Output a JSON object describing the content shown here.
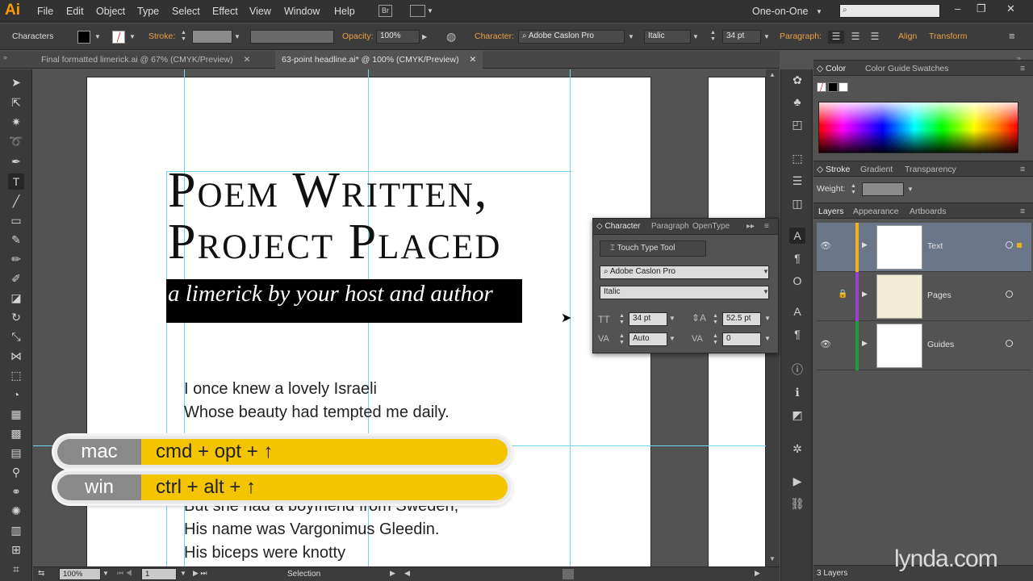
{
  "app": {
    "logo": "Ai",
    "workspace": "One-on-One"
  },
  "menu": [
    "File",
    "Edit",
    "Object",
    "Type",
    "Select",
    "Effect",
    "View",
    "Window",
    "Help"
  ],
  "menu_icons": [
    "Br"
  ],
  "control": {
    "label": "Characters",
    "stroke_label": "Stroke:",
    "opacity_label": "Opacity:",
    "opacity_value": "100%",
    "character_label": "Character:",
    "font": "Adobe Caslon Pro",
    "style": "Italic",
    "size": "34 pt",
    "paragraph_label": "Paragraph:",
    "align_label": "Align",
    "transform_label": "Transform"
  },
  "tabs": [
    {
      "label": "Final formatted limerick.ai @ 67% (CMYK/Preview)"
    },
    {
      "label": "63-point headline.ai* @ 100% (CMYK/Preview)"
    }
  ],
  "artwork": {
    "headline_line1": "Poem Written,",
    "headline_line2": "Project Placed",
    "subtitle": "a limerick by your host and author",
    "poem": [
      "I once knew a lovely Israeli",
      "Whose beauty had tempted me daily.",
      "But she had a boyfriend from Sweden,",
      "His name was Vargonimus Gleedin.",
      "His biceps were knotty"
    ]
  },
  "character_panel": {
    "tabs": [
      "Character",
      "Paragraph",
      "OpenType"
    ],
    "touch_type": "Touch Type Tool",
    "font": "Adobe Caslon Pro",
    "style": "Italic",
    "size": "34 pt",
    "leading": "52.5 pt",
    "kerning": "Auto",
    "tracking": "0"
  },
  "panels": {
    "color_tabs": [
      "Color",
      "Color Guide",
      "Swatches"
    ],
    "stroke_tabs": [
      "Stroke",
      "Gradient",
      "Transparency"
    ],
    "weight_label": "Weight:",
    "layers_tabs": [
      "Layers",
      "Appearance",
      "Artboards"
    ],
    "layers": [
      {
        "name": "Text",
        "color": "#f0b020",
        "visible": true,
        "locked": false
      },
      {
        "name": "Pages",
        "color": "#9b3fd0",
        "visible": false,
        "locked": true
      },
      {
        "name": "Guides",
        "color": "#1c9c3c",
        "visible": true,
        "locked": false
      }
    ],
    "layer_count": "3 Layers"
  },
  "status": {
    "zoom": "100%",
    "artboard": "1",
    "tool": "Selection"
  },
  "shortcut": {
    "mac_label": "mac",
    "mac_keys": "cmd + opt + ↑",
    "win_label": "win",
    "win_keys": "ctrl + alt + ↑"
  },
  "watermark": "lynda.com",
  "colors": {
    "accent": "#f5c400",
    "app_orange": "#ff9a00",
    "guide": "#74d3ee"
  }
}
